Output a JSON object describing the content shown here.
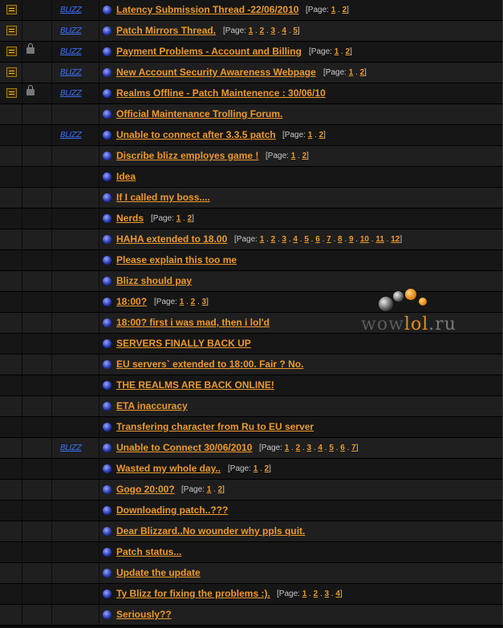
{
  "colors": {
    "link": "#ec9a2d",
    "row_dark": "#161616",
    "row_light": "#1f1f1f",
    "blizz": "#3d6ff0"
  },
  "icons": {
    "sticky": "sticky-note-icon",
    "lock": "lock-icon",
    "blizz": "blizz-badge-icon",
    "bullet": "thread-bullet-icon"
  },
  "page_prefix": "[Page: ",
  "page_suffix": "]",
  "page_sep": " . ",
  "watermark": {
    "part1": "wow",
    "part2": "lol",
    "part3": ".ru"
  },
  "threads": [
    {
      "title": "Latency Submission Thread -22/06/2010",
      "sticky": true,
      "locked": false,
      "blizz": true,
      "blizz_label": "BLIZZ",
      "pages": [
        "1",
        "2"
      ]
    },
    {
      "title": "Patch Mirrors Thread.",
      "sticky": true,
      "locked": false,
      "blizz": true,
      "blizz_label": "BLIZZ",
      "pages": [
        "1",
        "2",
        "3",
        "4",
        "5"
      ]
    },
    {
      "title": "Payment Problems - Account and Billing",
      "sticky": true,
      "locked": true,
      "blizz": true,
      "blizz_label": "BLIZZ",
      "pages": [
        "1",
        "2"
      ]
    },
    {
      "title": "New Account Security Awareness Webpage",
      "sticky": true,
      "locked": false,
      "blizz": true,
      "blizz_label": "BLIZZ",
      "pages": [
        "1",
        "2"
      ]
    },
    {
      "title": "Realms Offline - Patch Maintenence : 30/06/10",
      "sticky": true,
      "locked": true,
      "blizz": true,
      "blizz_label": "BLIZZ",
      "pages": []
    },
    {
      "title": "Official Maintenance Trolling Forum.",
      "sticky": false,
      "locked": false,
      "blizz": false,
      "pages": []
    },
    {
      "title": "Unable to connect after 3.3.5 patch",
      "sticky": false,
      "locked": false,
      "blizz": true,
      "blizz_label": "BLIZZ",
      "pages": [
        "1",
        "2"
      ]
    },
    {
      "title": "Discribe blizz employes game !",
      "sticky": false,
      "locked": false,
      "blizz": false,
      "pages": [
        "1",
        "2"
      ]
    },
    {
      "title": "Idea",
      "sticky": false,
      "locked": false,
      "blizz": false,
      "pages": []
    },
    {
      "title": "If I called my boss....",
      "sticky": false,
      "locked": false,
      "blizz": false,
      "pages": []
    },
    {
      "title": "Nerds",
      "sticky": false,
      "locked": false,
      "blizz": false,
      "pages": [
        "1",
        "2"
      ]
    },
    {
      "title": "HAHA extended to 18.00",
      "sticky": false,
      "locked": false,
      "blizz": false,
      "pages": [
        "1",
        "2",
        "3",
        "4",
        "5",
        "6",
        "7",
        "8",
        "9",
        "10",
        "11",
        "12"
      ]
    },
    {
      "title": "Please explain this too me",
      "sticky": false,
      "locked": false,
      "blizz": false,
      "pages": []
    },
    {
      "title": "Blizz should pay",
      "sticky": false,
      "locked": false,
      "blizz": false,
      "pages": []
    },
    {
      "title": "18:00?",
      "sticky": false,
      "locked": false,
      "blizz": false,
      "pages": [
        "1",
        "2",
        "3"
      ]
    },
    {
      "title": "18:00? first i was mad, then i lol'd",
      "sticky": false,
      "locked": false,
      "blizz": false,
      "pages": []
    },
    {
      "title": "SERVERS FINALLY BACK UP",
      "sticky": false,
      "locked": false,
      "blizz": false,
      "pages": []
    },
    {
      "title": "EU servers` extended to 18:00. Fair ? No.",
      "sticky": false,
      "locked": false,
      "blizz": false,
      "pages": []
    },
    {
      "title": "THE REALMS ARE BACK ONLINE!",
      "sticky": false,
      "locked": false,
      "blizz": false,
      "pages": []
    },
    {
      "title": "ETA inaccuracy",
      "sticky": false,
      "locked": false,
      "blizz": false,
      "pages": []
    },
    {
      "title": "Transfering character from Ru to EU server",
      "sticky": false,
      "locked": false,
      "blizz": false,
      "pages": []
    },
    {
      "title": "Unable to Connect 30/06/2010",
      "sticky": false,
      "locked": false,
      "blizz": true,
      "blizz_label": "BLIZZ",
      "pages": [
        "1",
        "2",
        "3",
        "4",
        "5",
        "6",
        "7"
      ]
    },
    {
      "title": "Wasted my whole day..",
      "sticky": false,
      "locked": false,
      "blizz": false,
      "pages": [
        "1",
        "2"
      ]
    },
    {
      "title": "Gogo 20:00?",
      "sticky": false,
      "locked": false,
      "blizz": false,
      "pages": [
        "1",
        "2"
      ]
    },
    {
      "title": "Downloading patch..???",
      "sticky": false,
      "locked": false,
      "blizz": false,
      "pages": []
    },
    {
      "title": "Dear Blizzard..No wounder why ppls quit.",
      "sticky": false,
      "locked": false,
      "blizz": false,
      "pages": []
    },
    {
      "title": "Patch status...",
      "sticky": false,
      "locked": false,
      "blizz": false,
      "pages": []
    },
    {
      "title": "Update the update",
      "sticky": false,
      "locked": false,
      "blizz": false,
      "pages": []
    },
    {
      "title": "Ty Blizz for fixing the problems :).",
      "sticky": false,
      "locked": false,
      "blizz": false,
      "pages": [
        "1",
        "2",
        "3",
        "4"
      ]
    },
    {
      "title": "Seriously??",
      "sticky": false,
      "locked": false,
      "blizz": false,
      "pages": []
    }
  ]
}
